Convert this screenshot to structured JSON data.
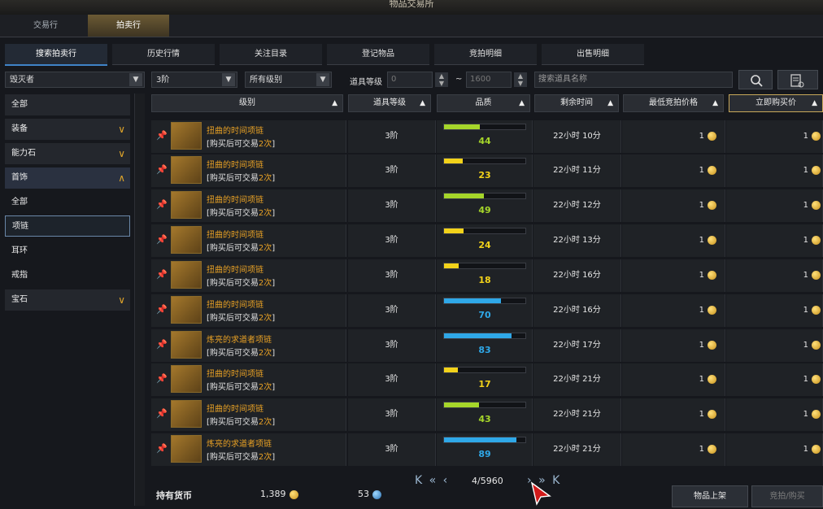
{
  "window": {
    "title": "物品交易所"
  },
  "top_tabs": [
    {
      "label": "交易行"
    },
    {
      "label": "拍卖行"
    }
  ],
  "sub_tabs": [
    {
      "label": "搜索拍卖行"
    },
    {
      "label": "历史行情"
    },
    {
      "label": "关注目录"
    },
    {
      "label": "登记物品"
    },
    {
      "label": "竞拍明细"
    },
    {
      "label": "出售明细"
    }
  ],
  "filters": {
    "class_select": "毁灭者",
    "tier_select": "3阶",
    "grade_select": "所有级别",
    "item_level_label": "道具等级",
    "item_level_min": "0",
    "item_level_sep": "~",
    "item_level_max": "1600",
    "search_placeholder": "搜索道具名称"
  },
  "sidebar": {
    "items": [
      {
        "label": "全部"
      },
      {
        "label": "装备",
        "chevron": "∨"
      },
      {
        "label": "能力石",
        "chevron": "∨"
      },
      {
        "label": "首饰",
        "chevron": "∧"
      },
      {
        "label": "全部"
      },
      {
        "label": "项链"
      },
      {
        "label": "耳环"
      },
      {
        "label": "戒指"
      },
      {
        "label": "宝石",
        "chevron": "∨"
      }
    ]
  },
  "table": {
    "headers": [
      "级别",
      "道具等级",
      "品质",
      "剩余时间",
      "最低竞拍价格",
      "立即购买价"
    ],
    "rows": [
      {
        "name": "扭曲的时间项链",
        "note": "[购买后可交易",
        "note_count": "2次",
        "note_end": "]",
        "tier": "3阶",
        "quality": 44,
        "quality_color": "#a6d62a",
        "time": "22小时 10分",
        "min_bid": "1",
        "buy_now": "1"
      },
      {
        "name": "扭曲的时间项链",
        "note": "[购买后可交易",
        "note_count": "2次",
        "note_end": "]",
        "tier": "3阶",
        "quality": 23,
        "quality_color": "#f2d21a",
        "time": "22小时 11分",
        "min_bid": "1",
        "buy_now": "1"
      },
      {
        "name": "扭曲的时间项链",
        "note": "[购买后可交易",
        "note_count": "2次",
        "note_end": "]",
        "tier": "3阶",
        "quality": 49,
        "quality_color": "#a6d62a",
        "time": "22小时 12分",
        "min_bid": "1",
        "buy_now": "1"
      },
      {
        "name": "扭曲的时间项链",
        "note": "[购买后可交易",
        "note_count": "2次",
        "note_end": "]",
        "tier": "3阶",
        "quality": 24,
        "quality_color": "#f2d21a",
        "time": "22小时 13分",
        "min_bid": "1",
        "buy_now": "1"
      },
      {
        "name": "扭曲的时间项链",
        "note": "[购买后可交易",
        "note_count": "2次",
        "note_end": "]",
        "tier": "3阶",
        "quality": 18,
        "quality_color": "#f2d21a",
        "time": "22小时 16分",
        "min_bid": "1",
        "buy_now": "1"
      },
      {
        "name": "扭曲的时间项链",
        "note": "[购买后可交易",
        "note_count": "2次",
        "note_end": "]",
        "tier": "3阶",
        "quality": 70,
        "quality_color": "#2fa8e8",
        "time": "22小时 16分",
        "min_bid": "1",
        "buy_now": "1"
      },
      {
        "name": "炼亮的求道者项链",
        "note": "[购买后可交易",
        "note_count": "2次",
        "note_end": "]",
        "tier": "3阶",
        "quality": 83,
        "quality_color": "#2fa8e8",
        "time": "22小时 17分",
        "min_bid": "1",
        "buy_now": "1"
      },
      {
        "name": "扭曲的时间项链",
        "note": "[购买后可交易",
        "note_count": "2次",
        "note_end": "]",
        "tier": "3阶",
        "quality": 17,
        "quality_color": "#f2d21a",
        "time": "22小时 21分",
        "min_bid": "1",
        "buy_now": "1"
      },
      {
        "name": "扭曲的时间项链",
        "note": "[购买后可交易",
        "note_count": "2次",
        "note_end": "]",
        "tier": "3阶",
        "quality": 43,
        "quality_color": "#a6d62a",
        "time": "22小时 21分",
        "min_bid": "1",
        "buy_now": "1"
      },
      {
        "name": "炼亮的求道者项链",
        "note": "[购买后可交易",
        "note_count": "2次",
        "note_end": "]",
        "tier": "3阶",
        "quality": 89,
        "quality_color": "#2fa8e8",
        "time": "22小时 21分",
        "min_bid": "1",
        "buy_now": "1"
      }
    ]
  },
  "pagination": {
    "first": "K",
    "prev_fast": "«",
    "prev": "‹",
    "page": "4/5960",
    "next": "›",
    "next_fast": "»",
    "last": "K"
  },
  "footer": {
    "currency_label": "持有货币",
    "gold": "1,389",
    "crystal": "53",
    "list_button": "物品上架",
    "bid_button": "竞拍/购买"
  },
  "colors": {
    "accent": "#e8a125",
    "tab_active": "#3f83c7"
  }
}
